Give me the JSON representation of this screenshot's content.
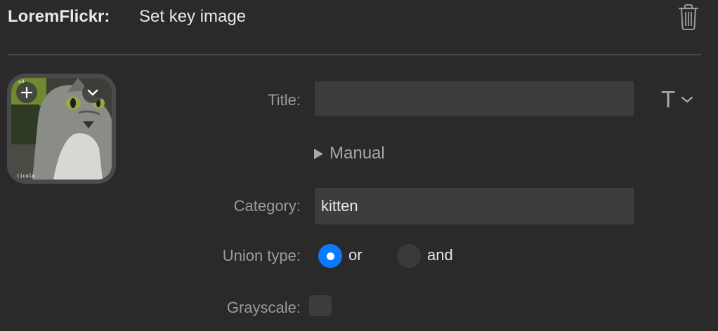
{
  "header": {
    "app_name": "LoremFlickr:",
    "action_name": "Set key image",
    "trash_icon": "trash-icon"
  },
  "thumbnail": {
    "caption_top": "nd",
    "caption_bottom": "ticola",
    "add_icon": "plus-icon",
    "menu_icon": "chevron-down-icon"
  },
  "form": {
    "title": {
      "label": "Title:",
      "value": ""
    },
    "text_menu": {
      "glyph": "T",
      "icon": "chevron-down-icon"
    },
    "manual": {
      "label": "Manual",
      "icon": "disclosure-triangle-icon"
    },
    "category": {
      "label": "Category:",
      "value": "kitten"
    },
    "union_type": {
      "label": "Union type:",
      "options": [
        {
          "label": "or",
          "selected": true
        },
        {
          "label": "and",
          "selected": false
        }
      ]
    },
    "grayscale": {
      "label": "Grayscale:",
      "checked": false
    }
  },
  "colors": {
    "background": "#2a2a2a",
    "accent": "#0a7aff",
    "field": "#3d3d3d",
    "label": "#9a9a9a"
  }
}
